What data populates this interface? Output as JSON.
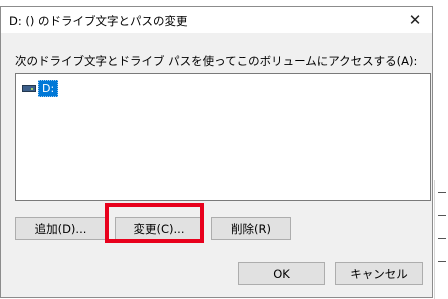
{
  "dialog": {
    "title": "D: () のドライブ文字とパスの変更",
    "close_glyph": "✕",
    "prompt": "次のドライブ文字とドライブ パスを使ってこのボリュームにアクセスする(A):"
  },
  "list": {
    "items": [
      {
        "label": "D:",
        "icon": "drive-icon"
      }
    ]
  },
  "buttons": {
    "add": "追加(D)...",
    "change": "変更(C)...",
    "delete": "削除(R)",
    "ok": "OK",
    "cancel": "キャンセル"
  },
  "annotation": {
    "highlight_color": "#e8001c"
  }
}
